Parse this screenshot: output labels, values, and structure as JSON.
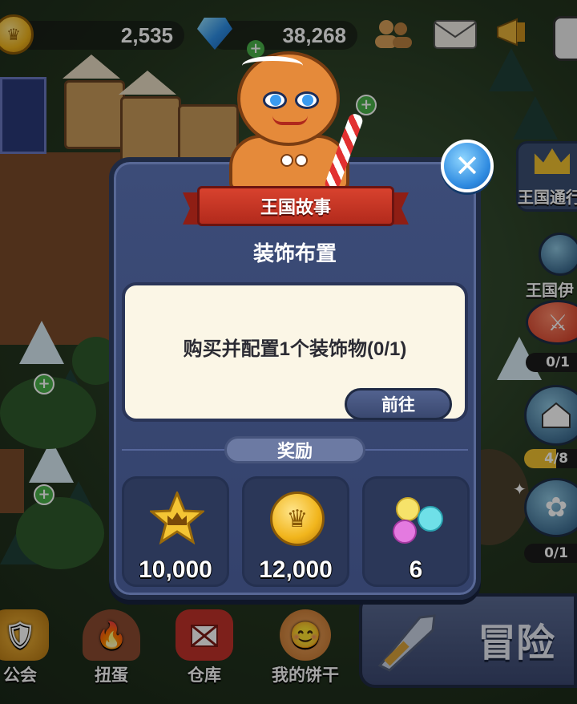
{
  "top_bar": {
    "coins": "2,535",
    "gems": "38,268"
  },
  "dialog": {
    "header": "王国故事",
    "title": "装饰布置",
    "task": "购买并配置1个装饰物(0/1)",
    "go_label": "前往",
    "reward_tab": "奖励",
    "rewards": [
      {
        "icon": "crown-star-icon",
        "value": "10,000"
      },
      {
        "icon": "gold-coin-icon",
        "value": "12,000"
      },
      {
        "icon": "rainbow-crystals-icon",
        "value": "6"
      }
    ]
  },
  "side_menu": {
    "pass_label": "王国通行",
    "events_label": "王国伊",
    "items": [
      {
        "name": "sword",
        "count": "0/1"
      },
      {
        "name": "house",
        "count": "4/8",
        "progress": 0.5
      },
      {
        "name": "flower",
        "count": "0/1"
      }
    ]
  },
  "bottom_nav": {
    "items": [
      {
        "label": "公会"
      },
      {
        "label": "扭蛋"
      },
      {
        "label": "仓库"
      },
      {
        "label": "我的饼干"
      }
    ],
    "adventure_label": "冒险"
  },
  "colors": {
    "panel": "#3c4c78",
    "ribbon": "#d8422e",
    "card": "#fbf6e6",
    "close": "#2e8ae0"
  }
}
